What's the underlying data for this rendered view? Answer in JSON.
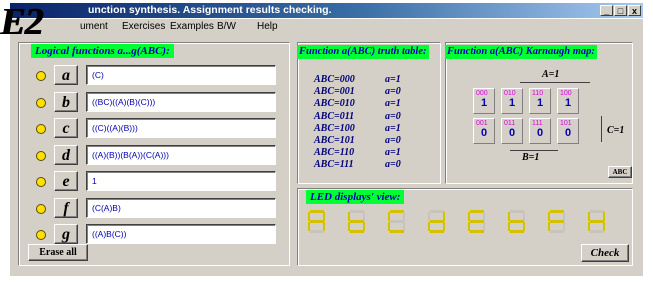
{
  "app": {
    "logo": "E2",
    "title": "unction synthesis. Assignment results checking.",
    "window_controls": {
      "minimize": "_",
      "maximize": "□",
      "close": "x"
    }
  },
  "menu": [
    "ument",
    "Exercises",
    "Examples",
    "B/W",
    "Help"
  ],
  "functions_panel": {
    "title": "Logical functions a...g(ABC):",
    "rows": [
      {
        "letter": "a",
        "expr": "(C)"
      },
      {
        "letter": "b",
        "expr": "((BC)((A)(B)(C)))"
      },
      {
        "letter": "c",
        "expr": "((C)((A)(B)))"
      },
      {
        "letter": "d",
        "expr": "((A)(B))(B(A))(C(A)))"
      },
      {
        "letter": "e",
        "expr": "1"
      },
      {
        "letter": "f",
        "expr": "(C(A)B)"
      },
      {
        "letter": "g",
        "expr": "((A)B(C))"
      }
    ],
    "erase_label": "Erase all"
  },
  "truth_table": {
    "title": "Function a(ABC) truth table:",
    "rows": [
      {
        "abc": "ABC=000",
        "val": "a=1"
      },
      {
        "abc": "ABC=001",
        "val": "a=0"
      },
      {
        "abc": "ABC=010",
        "val": "a=1"
      },
      {
        "abc": "ABC=011",
        "val": "a=0"
      },
      {
        "abc": "ABC=100",
        "val": "a=1"
      },
      {
        "abc": "ABC=101",
        "val": "a=0"
      },
      {
        "abc": "ABC=110",
        "val": "a=1"
      },
      {
        "abc": "ABC=111",
        "val": "a=0"
      }
    ]
  },
  "karnaugh": {
    "title": "Function a(ABC) Karnaugh map:",
    "label_a": "A=1",
    "label_b": "B=1",
    "label_c": "C=1",
    "row1": [
      {
        "idx": "000",
        "val": "1"
      },
      {
        "idx": "010",
        "val": "1"
      },
      {
        "idx": "110",
        "val": "1"
      },
      {
        "idx": "100",
        "val": "1"
      }
    ],
    "row2": [
      {
        "idx": "001",
        "val": "0"
      },
      {
        "idx": "011",
        "val": "0"
      },
      {
        "idx": "111",
        "val": "0"
      },
      {
        "idx": "101",
        "val": "0"
      }
    ],
    "abc_button": "ABC"
  },
  "led_panel": {
    "title": "LED displays' view:",
    "displays": [
      "A",
      "b",
      "C",
      "d",
      "E",
      "b",
      "F",
      "H"
    ],
    "led_color": "#d4c200",
    "check_label": "Check"
  },
  "colors": {
    "title_green": "#00ff33",
    "title_text": "#0000b0",
    "radio_yellow": "#ffe000",
    "karnaugh_index": "#e000e0"
  }
}
